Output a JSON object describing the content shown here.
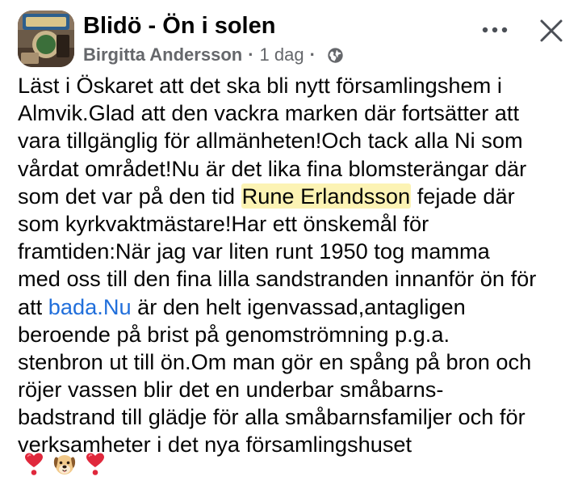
{
  "header": {
    "group_name": "Blidö - Ön i solen",
    "author": "Birgitta Andersson",
    "separator": "·",
    "timestamp": "1 dag",
    "privacy_icon": "globe-icon",
    "more_icon": "more-horizontal-icon",
    "close_icon": "close-icon"
  },
  "post": {
    "lines": [
      "Läst i Öskaret att det ska bli nytt församlingshem i",
      "Almvik.Glad att den vackra marken där fortsätter att",
      "vara tillgänglig för allmänheten!Och tack alla Ni som",
      "vårdat området!Nu är det lika fina blomsterängar där"
    ],
    "line5_before": "som det var på den tid ",
    "mention": "Rune Erlandsson",
    "line5_after": " fejade där",
    "lines_b": [
      "som kyrkvaktmästare!Har ett önskemål för",
      "framtiden:När jag var liten runt 1950 tog mamma",
      "med oss till den fina lilla sandstranden innanför ön för"
    ],
    "line9_before": "att ",
    "link": "bada.Nu",
    "line9_after": " är den helt igenvassad,antagligen",
    "lines_c": [
      "beroende på brist på genomströmning p.g.a.",
      "stenbron ut till ön.Om man gör en spång på bron och",
      "röjer vassen blir det en underbar småbarns-",
      "badstrand till glädje för alla småbarnsfamiljer och för",
      "verksamheter i det nya församlingshuset"
    ],
    "emojis": [
      "heart-exclamation-icon",
      "dog-face-icon",
      "heart-exclamation-icon"
    ]
  },
  "colors": {
    "text": "#050505",
    "secondary": "#65676b",
    "link": "#216fdb",
    "mention_highlight": "#fcf3b4"
  }
}
